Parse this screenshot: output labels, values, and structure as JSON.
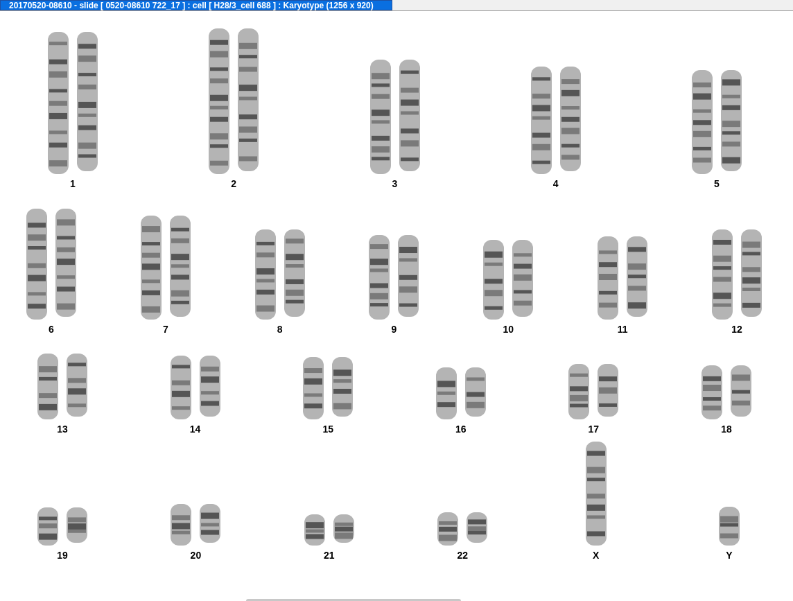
{
  "window": {
    "title": "20170520-08610 - slide [ 0520-08610 722_17 ] : cell [ H28/3_cell 688 ] : Karyotype  (1256 x 920)"
  },
  "rows": [
    {
      "pairs": [
        {
          "label": "1",
          "kind": "pair"
        },
        {
          "label": "2",
          "kind": "pair"
        },
        {
          "label": "3",
          "kind": "pair"
        },
        {
          "label": "4",
          "kind": "pair"
        },
        {
          "label": "5",
          "kind": "pair"
        }
      ]
    },
    {
      "pairs": [
        {
          "label": "6",
          "kind": "pair"
        },
        {
          "label": "7",
          "kind": "pair"
        },
        {
          "label": "8",
          "kind": "pair"
        },
        {
          "label": "9",
          "kind": "pair"
        },
        {
          "label": "10",
          "kind": "pair"
        },
        {
          "label": "11",
          "kind": "pair"
        },
        {
          "label": "12",
          "kind": "pair"
        }
      ]
    },
    {
      "pairs": [
        {
          "label": "13",
          "kind": "pair"
        },
        {
          "label": "14",
          "kind": "pair"
        },
        {
          "label": "15",
          "kind": "pair"
        },
        {
          "label": "16",
          "kind": "pair"
        },
        {
          "label": "17",
          "kind": "pair"
        },
        {
          "label": "18",
          "kind": "pair"
        }
      ]
    },
    {
      "pairs": [
        {
          "label": "19",
          "kind": "pair"
        },
        {
          "label": "20",
          "kind": "pair"
        },
        {
          "label": "21",
          "kind": "pair"
        },
        {
          "label": "22",
          "kind": "pair"
        },
        {
          "label": "X",
          "kind": "single"
        },
        {
          "label": "Y",
          "kind": "single"
        }
      ]
    }
  ]
}
